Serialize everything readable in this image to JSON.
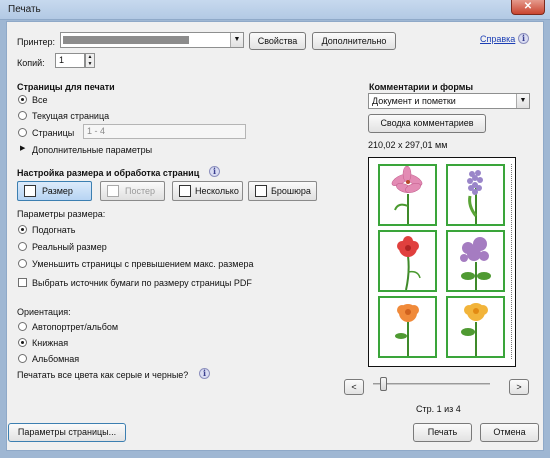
{
  "window": {
    "title": "Печать",
    "close_label": "✕",
    "help_link": "Справка"
  },
  "printer": {
    "label": "Принтер:",
    "properties_button": "Свойства",
    "advanced_button": "Дополнительно"
  },
  "copies": {
    "label": "Копий:",
    "value": "1"
  },
  "pages": {
    "header": "Страницы для печати",
    "options": [
      {
        "label": "Все",
        "selected": true
      },
      {
        "label": "Текущая страница",
        "selected": false
      },
      {
        "label": "Страницы",
        "selected": false
      }
    ],
    "range_value": "1 - 4",
    "more_options": "Дополнительные параметры"
  },
  "sizing": {
    "header": "Настройка размера и обработка страниц",
    "tabs": [
      {
        "label": "Размер",
        "active": true,
        "disabled": false
      },
      {
        "label": "Постер",
        "active": false,
        "disabled": true
      },
      {
        "label": "Несколько",
        "active": false,
        "disabled": false
      },
      {
        "label": "Брошюра",
        "active": false,
        "disabled": false
      }
    ],
    "params_label": "Параметры размера:",
    "options": [
      {
        "label": "Подогнать",
        "selected": true
      },
      {
        "label": "Реальный размер",
        "selected": false
      },
      {
        "label": "Уменьшить страницы с превышением макс. размера",
        "selected": false
      }
    ],
    "paper_source_checkbox": "Выбрать источник бумаги по размеру страницы PDF"
  },
  "orientation": {
    "label": "Ориентация:",
    "options": [
      {
        "label": "Автопортрет/альбом",
        "selected": false
      },
      {
        "label": "Книжная",
        "selected": true
      },
      {
        "label": "Альбомная",
        "selected": false
      }
    ],
    "grayscale_question": "Печатать все цвета как серые и черные?"
  },
  "comments": {
    "header": "Комментарии и формы",
    "selected": "Документ и пометки",
    "summary_button": "Сводка комментариев"
  },
  "preview": {
    "dimensions": "210,02 x 297,01 мм",
    "page_indicator": "Стр. 1 из 4",
    "prev": "<",
    "next": ">"
  },
  "footer": {
    "page_setup": "Параметры страницы...",
    "print": "Печать",
    "cancel": "Отмена"
  },
  "icons": {
    "info": "i"
  }
}
